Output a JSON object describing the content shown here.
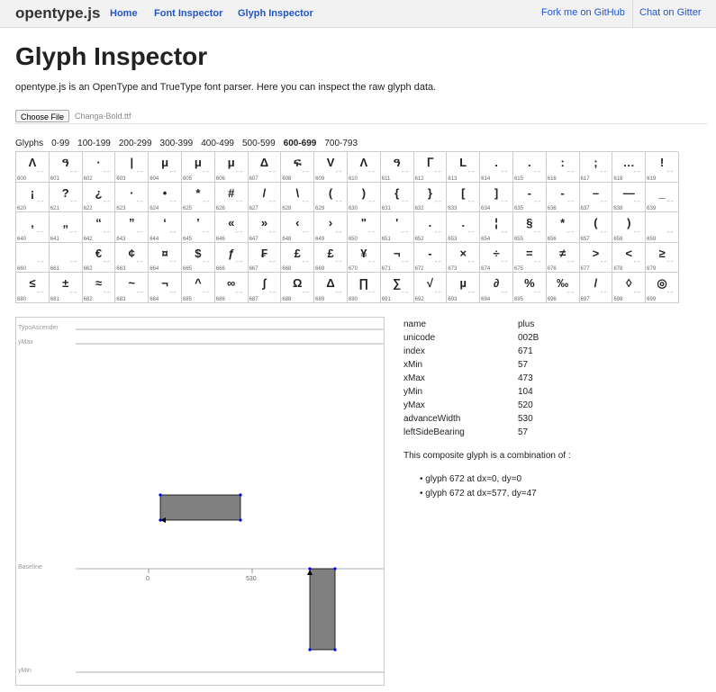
{
  "nav": {
    "brand": "opentype.js",
    "links": [
      "Home",
      "Font Inspector",
      "Glyph Inspector"
    ],
    "right_links": [
      "Fork me on GitHub",
      "Chat on Gitter"
    ]
  },
  "page": {
    "title": "Glyph Inspector",
    "subtitle": "opentype.js is an OpenType and TrueType font parser. Here you can inspect the raw glyph data."
  },
  "file": {
    "button_label": "Choose File",
    "filename": "Changa-Bold.ttf"
  },
  "ranges": {
    "label": "Glyphs",
    "items": [
      "0-99",
      "100-199",
      "200-299",
      "300-399",
      "400-499",
      "500-599",
      "600-699",
      "700-793"
    ],
    "active": "600-699"
  },
  "glyphs": [
    {
      "n": "600",
      "g": "Λ"
    },
    {
      "n": "601",
      "g": "ዓ"
    },
    {
      "n": "602",
      "g": "·"
    },
    {
      "n": "603",
      "g": "|"
    },
    {
      "n": "604",
      "g": "μ"
    },
    {
      "n": "605",
      "g": "μ"
    },
    {
      "n": "606",
      "g": "μ"
    },
    {
      "n": "607",
      "g": "Δ"
    },
    {
      "n": "608",
      "g": "ፍ"
    },
    {
      "n": "609",
      "g": "V"
    },
    {
      "n": "610",
      "g": "Λ"
    },
    {
      "n": "611",
      "g": "ዓ"
    },
    {
      "n": "612",
      "g": "ᒥ"
    },
    {
      "n": "613",
      "g": "L"
    },
    {
      "n": "614",
      "g": "."
    },
    {
      "n": "615",
      "g": "."
    },
    {
      "n": "616",
      "g": ":"
    },
    {
      "n": "617",
      "g": ";"
    },
    {
      "n": "618",
      "g": "…"
    },
    {
      "n": "619",
      "g": "!"
    },
    {
      "n": "620",
      "g": "¡"
    },
    {
      "n": "621",
      "g": "?"
    },
    {
      "n": "622",
      "g": "¿"
    },
    {
      "n": "623",
      "g": "·"
    },
    {
      "n": "624",
      "g": "•"
    },
    {
      "n": "625",
      "g": "*"
    },
    {
      "n": "626",
      "g": "#"
    },
    {
      "n": "627",
      "g": "/"
    },
    {
      "n": "628",
      "g": "\\"
    },
    {
      "n": "629",
      "g": "("
    },
    {
      "n": "630",
      "g": ")"
    },
    {
      "n": "631",
      "g": "{"
    },
    {
      "n": "632",
      "g": "}"
    },
    {
      "n": "633",
      "g": "["
    },
    {
      "n": "634",
      "g": "]"
    },
    {
      "n": "635",
      "g": "-"
    },
    {
      "n": "636",
      "g": "-"
    },
    {
      "n": "637",
      "g": "–"
    },
    {
      "n": "638",
      "g": "—"
    },
    {
      "n": "639",
      "g": "_"
    },
    {
      "n": "640",
      "g": "‚"
    },
    {
      "n": "641",
      "g": "„"
    },
    {
      "n": "642",
      "g": "“"
    },
    {
      "n": "643",
      "g": "”"
    },
    {
      "n": "644",
      "g": "‘"
    },
    {
      "n": "645",
      "g": "’"
    },
    {
      "n": "646",
      "g": "«"
    },
    {
      "n": "647",
      "g": "»"
    },
    {
      "n": "648",
      "g": "‹"
    },
    {
      "n": "649",
      "g": "›"
    },
    {
      "n": "650",
      "g": "\""
    },
    {
      "n": "651",
      "g": "'"
    },
    {
      "n": "652",
      "g": "."
    },
    {
      "n": "653",
      "g": "."
    },
    {
      "n": "654",
      "g": "¦"
    },
    {
      "n": "655",
      "g": "§"
    },
    {
      "n": "656",
      "g": "*"
    },
    {
      "n": "657",
      "g": "("
    },
    {
      "n": "658",
      "g": ")"
    },
    {
      "n": "659",
      "g": ""
    },
    {
      "n": "660",
      "g": ""
    },
    {
      "n": "661",
      "g": ""
    },
    {
      "n": "662",
      "g": "€"
    },
    {
      "n": "663",
      "g": "¢"
    },
    {
      "n": "664",
      "g": "¤"
    },
    {
      "n": "665",
      "g": "$"
    },
    {
      "n": "666",
      "g": "ƒ"
    },
    {
      "n": "667",
      "g": "₣"
    },
    {
      "n": "668",
      "g": "£"
    },
    {
      "n": "669",
      "g": "£"
    },
    {
      "n": "670",
      "g": "¥"
    },
    {
      "n": "671",
      "g": "¬"
    },
    {
      "n": "672",
      "g": "-"
    },
    {
      "n": "673",
      "g": "×"
    },
    {
      "n": "674",
      "g": "÷"
    },
    {
      "n": "675",
      "g": "="
    },
    {
      "n": "676",
      "g": "≠"
    },
    {
      "n": "677",
      "g": ">"
    },
    {
      "n": "678",
      "g": "<"
    },
    {
      "n": "679",
      "g": "≥"
    },
    {
      "n": "680",
      "g": "≤"
    },
    {
      "n": "681",
      "g": "±"
    },
    {
      "n": "682",
      "g": "≈"
    },
    {
      "n": "683",
      "g": "~"
    },
    {
      "n": "684",
      "g": "¬"
    },
    {
      "n": "685",
      "g": "^"
    },
    {
      "n": "686",
      "g": "∞"
    },
    {
      "n": "687",
      "g": "∫"
    },
    {
      "n": "688",
      "g": "Ω"
    },
    {
      "n": "689",
      "g": "Δ"
    },
    {
      "n": "690",
      "g": "∏"
    },
    {
      "n": "691",
      "g": "∑"
    },
    {
      "n": "692",
      "g": "√"
    },
    {
      "n": "693",
      "g": "µ"
    },
    {
      "n": "694",
      "g": "∂"
    },
    {
      "n": "695",
      "g": "%"
    },
    {
      "n": "696",
      "g": "‰"
    },
    {
      "n": "697",
      "g": "/"
    },
    {
      "n": "698",
      "g": "◊"
    },
    {
      "n": "699",
      "g": "◎"
    }
  ],
  "canvas": {
    "labels": {
      "top": "TypoAscender",
      "ymax": "yMax",
      "baseline": "Baseline",
      "ymin": "yMin"
    },
    "ticks": [
      "0",
      "530"
    ]
  },
  "info": {
    "rows": [
      {
        "k": "name",
        "v": "plus"
      },
      {
        "k": "unicode",
        "v": "002B"
      },
      {
        "k": "index",
        "v": "671"
      },
      {
        "k": "xMin",
        "v": "57"
      },
      {
        "k": "xMax",
        "v": "473"
      },
      {
        "k": "yMin",
        "v": "104"
      },
      {
        "k": "yMax",
        "v": "520"
      },
      {
        "k": "advanceWidth",
        "v": "530"
      },
      {
        "k": "leftSideBearing",
        "v": "57"
      }
    ],
    "composite_text": "This composite glyph is a combination of :",
    "components": [
      "glyph 672 at dx=0, dy=0",
      "glyph 672 at dx=577, dy=47"
    ]
  }
}
